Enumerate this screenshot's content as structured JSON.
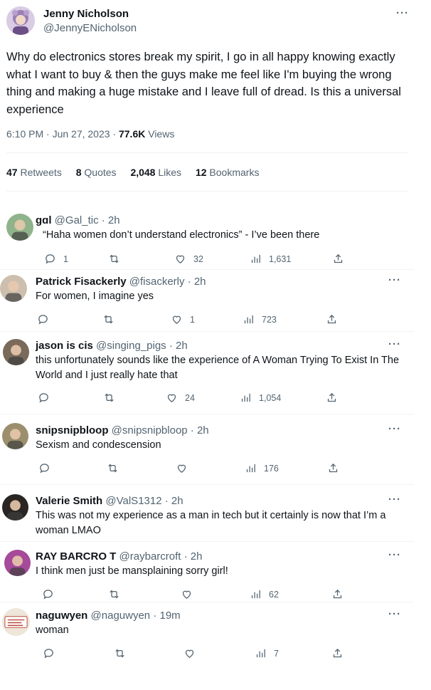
{
  "main_tweet": {
    "name": "Jenny Nicholson",
    "handle": "@JennyENicholson",
    "text": "Why do electronics stores break my spirit, I go in all happy knowing exactly what I want to buy & then the guys make me feel like I'm buying the wrong thing and making a huge mistake and I leave full of dread. Is this a universal experience",
    "time": "6:10 PM · Jun 27, 2023 · ",
    "views_count": "77.6K",
    "views_label": " Views",
    "stats": {
      "retweets_count": "47",
      "retweets_label": " Retweets",
      "quotes_count": "8",
      "quotes_label": " Quotes",
      "likes_count": "2,048",
      "likes_label": " Likes",
      "bookmarks_count": "12",
      "bookmarks_label": " Bookmarks"
    },
    "more": "···"
  },
  "replies": [
    {
      "name": "ɡɑl",
      "handle_time": "@Gal_tic · 2h",
      "text": "“Haha women don’t understand electronics” - I’ve been there",
      "replies": "1",
      "retweets": "",
      "likes": "32",
      "views": "1,631",
      "more": ""
    },
    {
      "name": "Patrick Fisackerly",
      "handle_time": "@fisackerly · 2h",
      "text": "For women, I imagine yes",
      "replies": "",
      "retweets": "",
      "likes": "1",
      "views": "723",
      "more": "···"
    },
    {
      "name": "jason is cis",
      "handle_time": "@singing_pigs · 2h",
      "text": "this unfortunately sounds like the experience of A Woman Trying To Exist In The World and I just really hate that",
      "replies": "",
      "retweets": "",
      "likes": "24",
      "views": "1,054",
      "more": "···"
    },
    {
      "name": "snipsnipbloop",
      "handle_time": "@snipsnipbloop · 2h",
      "text": "Sexism and condescension",
      "replies": "",
      "retweets": "",
      "likes": "",
      "views": "176",
      "more": "···"
    },
    {
      "name": "Valerie Smith",
      "handle_time": "@ValS1312 · 2h",
      "text": "This was not my experience as a man in tech but it certainly is now that I’m a woman LMAO",
      "more": "···"
    },
    {
      "name": "RAY BARCRO T",
      "handle_time": "@raybarcroft · 2h",
      "text": "I think men just be mansplaining sorry girl!",
      "replies": "",
      "retweets": "",
      "likes": "",
      "views": "62",
      "more": "···"
    },
    {
      "name": "naguwyen",
      "handle_time": "@naguwyen · 19m",
      "text": "woman",
      "replies": "",
      "retweets": "",
      "likes": "",
      "views": "7",
      "more": "···"
    }
  ],
  "avatar_sign_text": "COFFEE IS MY FAVORITE",
  "colors": {
    "text": "#0f1419",
    "muted": "#536471",
    "divider": "#eff3f4"
  }
}
